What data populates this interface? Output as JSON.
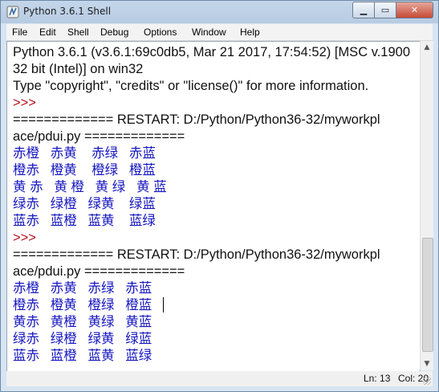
{
  "window": {
    "title": "Python 3.6.1 Shell",
    "buttons": {
      "minimize": "▁",
      "maximize": "▭",
      "close": "✕"
    }
  },
  "menu": [
    "File",
    "Edit",
    "Shell",
    "Debug",
    "Options",
    "Window",
    "Help"
  ],
  "editor": {
    "lines": [
      {
        "text": "Python 3.6.1 (v3.6.1:69c0db5, Mar 21 2017, 17:54:52) [MSC v.1900",
        "style": "black"
      },
      {
        "text": "32 bit (Intel)] on win32",
        "style": "black"
      },
      {
        "text": "Type \"copyright\", \"credits\" or \"license()\" for more information.",
        "style": "black"
      },
      {
        "text": ">>>",
        "style": "red"
      },
      {
        "text": "============= RESTART: D:/Python/Python36-32/myworkpl",
        "style": "black"
      },
      {
        "text": "ace/pdui.py =============",
        "style": "black"
      },
      {
        "text": "赤橙   赤黄    赤绿   赤蓝",
        "style": "blue"
      },
      {
        "text": "橙赤   橙黄    橙绿   橙蓝",
        "style": "blue"
      },
      {
        "text": "黄 赤   黄 橙   黄 绿   黄 蓝",
        "style": "blue"
      },
      {
        "text": "绿赤   绿橙   绿黄    绿蓝",
        "style": "blue"
      },
      {
        "text": "蓝赤   蓝橙   蓝黄    蓝绿",
        "style": "blue"
      },
      {
        "text": ">>>",
        "style": "red"
      },
      {
        "text": "============= RESTART: D:/Python/Python36-32/myworkpl",
        "style": "black"
      },
      {
        "text": "ace/pdui.py =============",
        "style": "black"
      },
      {
        "text": "赤橙   赤黄   赤绿   赤蓝",
        "style": "blue"
      },
      {
        "text": "橙赤   橙黄   橙绿   橙蓝",
        "style": "blue"
      },
      {
        "text": "黄赤   黄橙   黄绿   黄蓝",
        "style": "blue"
      },
      {
        "text": "绿赤   绿橙   绿黄   绿蓝",
        "style": "blue"
      },
      {
        "text": "蓝赤   蓝橙   蓝黄   蓝绿",
        "style": "blue"
      }
    ]
  },
  "status": {
    "line": "Ln: 13",
    "col": "Col: 20"
  },
  "colors": {
    "prompt": "#b5121b",
    "output": "#1616c0",
    "text": "#111111"
  }
}
